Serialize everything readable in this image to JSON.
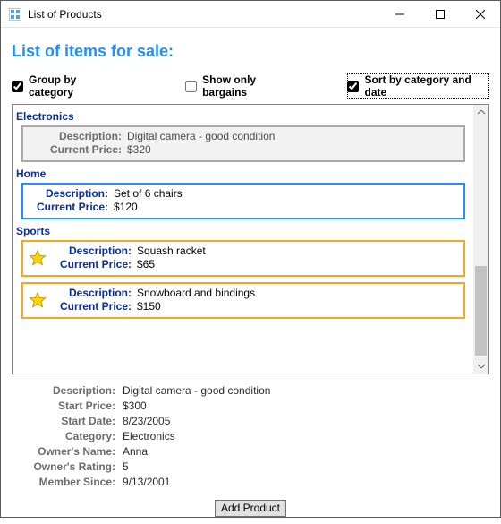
{
  "window": {
    "title": "List of Products"
  },
  "header": {
    "title": "List of items for sale:"
  },
  "options": {
    "group_by_category": {
      "label": "Group by category",
      "checked": true
    },
    "show_only_bargains": {
      "label": "Show only bargains",
      "checked": false
    },
    "sort_by_category_and_date": {
      "label": "Sort by category and date",
      "checked": true
    }
  },
  "list": {
    "desc_label": "Description:",
    "price_label": "Current Price:",
    "groups": [
      {
        "name": "Electronics",
        "items": [
          {
            "description": "Digital camera - good condition",
            "price": "$320",
            "style": "gray",
            "starred": false
          }
        ]
      },
      {
        "name": "Home",
        "items": [
          {
            "description": "Set of 6 chairs",
            "price": "$120",
            "style": "blue",
            "starred": false
          }
        ]
      },
      {
        "name": "Sports",
        "items": [
          {
            "description": "Squash racket",
            "price": "$65",
            "style": "orange",
            "starred": true
          },
          {
            "description": "Snowboard and bindings",
            "price": "$150",
            "style": "orange",
            "starred": true
          }
        ]
      }
    ]
  },
  "details": {
    "labels": {
      "description": "Description:",
      "start_price": "Start Price:",
      "start_date": "Start Date:",
      "category": "Category:",
      "owner_name": "Owner's Name:",
      "owner_rating": "Owner's Rating:",
      "member_since": "Member Since:"
    },
    "values": {
      "description": "Digital camera - good condition",
      "start_price": "$300",
      "start_date": "8/23/2005",
      "category": "Electronics",
      "owner_name": "Anna",
      "owner_rating": "5",
      "member_since": "9/13/2001"
    }
  },
  "buttons": {
    "add_product": "Add Product"
  }
}
